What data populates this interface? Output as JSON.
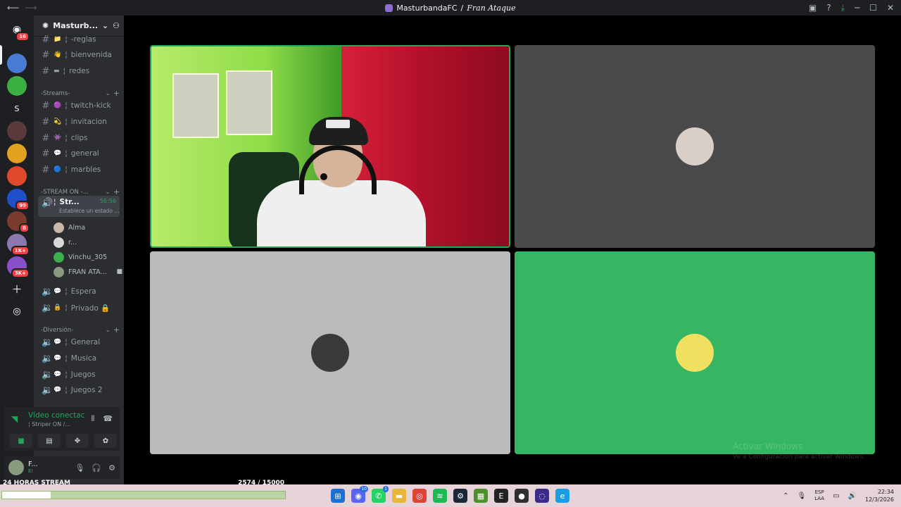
{
  "window": {
    "server_name": "MasturbandaFC",
    "separator": "/",
    "channel_name": "Fran Ataque"
  },
  "rail": {
    "dm_badge": "16",
    "servers": [
      {
        "letter": "",
        "color": "#4a7bd4",
        "badge": ""
      },
      {
        "letter": "",
        "color": "#3cb043",
        "badge": ""
      },
      {
        "letter": "S",
        "color": "#1e1f22",
        "badge": ""
      },
      {
        "letter": "",
        "color": "#5a3a3a",
        "badge": ""
      },
      {
        "letter": "",
        "color": "#e2a11e",
        "badge": ""
      },
      {
        "letter": "",
        "color": "#e0492b",
        "badge": ""
      },
      {
        "letter": "",
        "color": "#2050c8",
        "badge": "99"
      },
      {
        "letter": "",
        "color": "#7a3b2e",
        "badge": "8"
      },
      {
        "letter": "",
        "color": "#8a7ab0",
        "badge": "1K+"
      },
      {
        "letter": "",
        "color": "#8b4fc9",
        "badge": "3K+"
      }
    ]
  },
  "sidebar": {
    "header_name": "Masturb...",
    "channels_top": [
      {
        "emoji": "📁",
        "name": "-reglas"
      },
      {
        "emoji": "👋",
        "name": "bienvenida"
      },
      {
        "emoji": "▬",
        "name": "redes"
      }
    ],
    "category_streams": "-Streams-",
    "channels_streams": [
      {
        "emoji": "🟣",
        "name": "twitch-kick"
      },
      {
        "emoji": "💫",
        "name": "invitacion"
      },
      {
        "emoji": "👾",
        "name": "clips"
      },
      {
        "emoji": "💬",
        "name": "general"
      },
      {
        "emoji": "🔵",
        "name": "marbles"
      }
    ],
    "category_stream_on": "-STREAM ON -...",
    "active_voice": {
      "name": "Str...",
      "prefix": "¦",
      "timer": "56:56",
      "status": "Establece un estado ..."
    },
    "voice_users": [
      {
        "name": "Alma",
        "color": "#c8b8a8"
      },
      {
        "name": "r...",
        "color": "#d8d8d8"
      },
      {
        "name": "Vinchu_305",
        "color": "#3cb04e"
      },
      {
        "name": "FRAN ATA...",
        "color": "#8a9a7f"
      }
    ],
    "voice_channels_1": [
      {
        "emoji": "💬",
        "name": "Espera"
      },
      {
        "emoji": "🔒",
        "name": "Privado 🔒"
      }
    ],
    "category_diversion": "-Diversión-",
    "voice_channels_2": [
      {
        "emoji": "💬",
        "name": "General"
      },
      {
        "emoji": "💬",
        "name": "Musica"
      },
      {
        "emoji": "💬",
        "name": "Juegos"
      },
      {
        "emoji": "💬",
        "name": "Juegos 2"
      }
    ]
  },
  "voice_panel": {
    "status": "Vídeo conectac",
    "channel": "¦ Striper ON /..."
  },
  "user_panel": {
    "name": "F...",
    "status": "Ei"
  },
  "tiles": [
    {
      "kind": "camera",
      "bg": "#c0e060"
    },
    {
      "kind": "avatar",
      "bg": "#4a494b",
      "avatar_color": "#d8d0c8"
    },
    {
      "kind": "avatar",
      "bg": "#bbbbbb",
      "avatar_color": "#3a3a3a"
    },
    {
      "kind": "avatar",
      "bg": "#36b563",
      "avatar_color": "#f0e060"
    }
  ],
  "overlay": {
    "title": "24 HORAS STREAM",
    "counter": "2574 / 15000",
    "progress": 0.1716
  },
  "watermark": {
    "line1": "Activar Windows",
    "line2": "Ve a Configuración para activar Windows."
  },
  "taskbar": {
    "apps": [
      {
        "icon": "windows-icon",
        "color": "#1f6fd0",
        "badge": ""
      },
      {
        "icon": "discord-icon",
        "color": "#5865f2",
        "badge": "10"
      },
      {
        "icon": "whatsapp-icon",
        "color": "#25d366",
        "badge": "1"
      },
      {
        "icon": "folder-icon",
        "color": "#e8b63a",
        "badge": ""
      },
      {
        "icon": "chrome-icon",
        "color": "#db4437",
        "badge": ""
      },
      {
        "icon": "spotify-icon",
        "color": "#1db954",
        "badge": ""
      },
      {
        "icon": "steam-icon",
        "color": "#1b2838",
        "badge": ""
      },
      {
        "icon": "minecraft-icon",
        "color": "#4d8f2b",
        "badge": ""
      },
      {
        "icon": "epic-icon",
        "color": "#222222",
        "badge": ""
      },
      {
        "icon": "obs-icon",
        "color": "#302e31",
        "badge": ""
      },
      {
        "icon": "browser-icon",
        "color": "#3a2a8a",
        "badge": ""
      },
      {
        "icon": "edge-icon",
        "color": "#1b9de2",
        "badge": ""
      }
    ],
    "lang_top": "ESP",
    "lang_bottom": "LAA",
    "time": "22:34",
    "date": "12/3/2026"
  }
}
